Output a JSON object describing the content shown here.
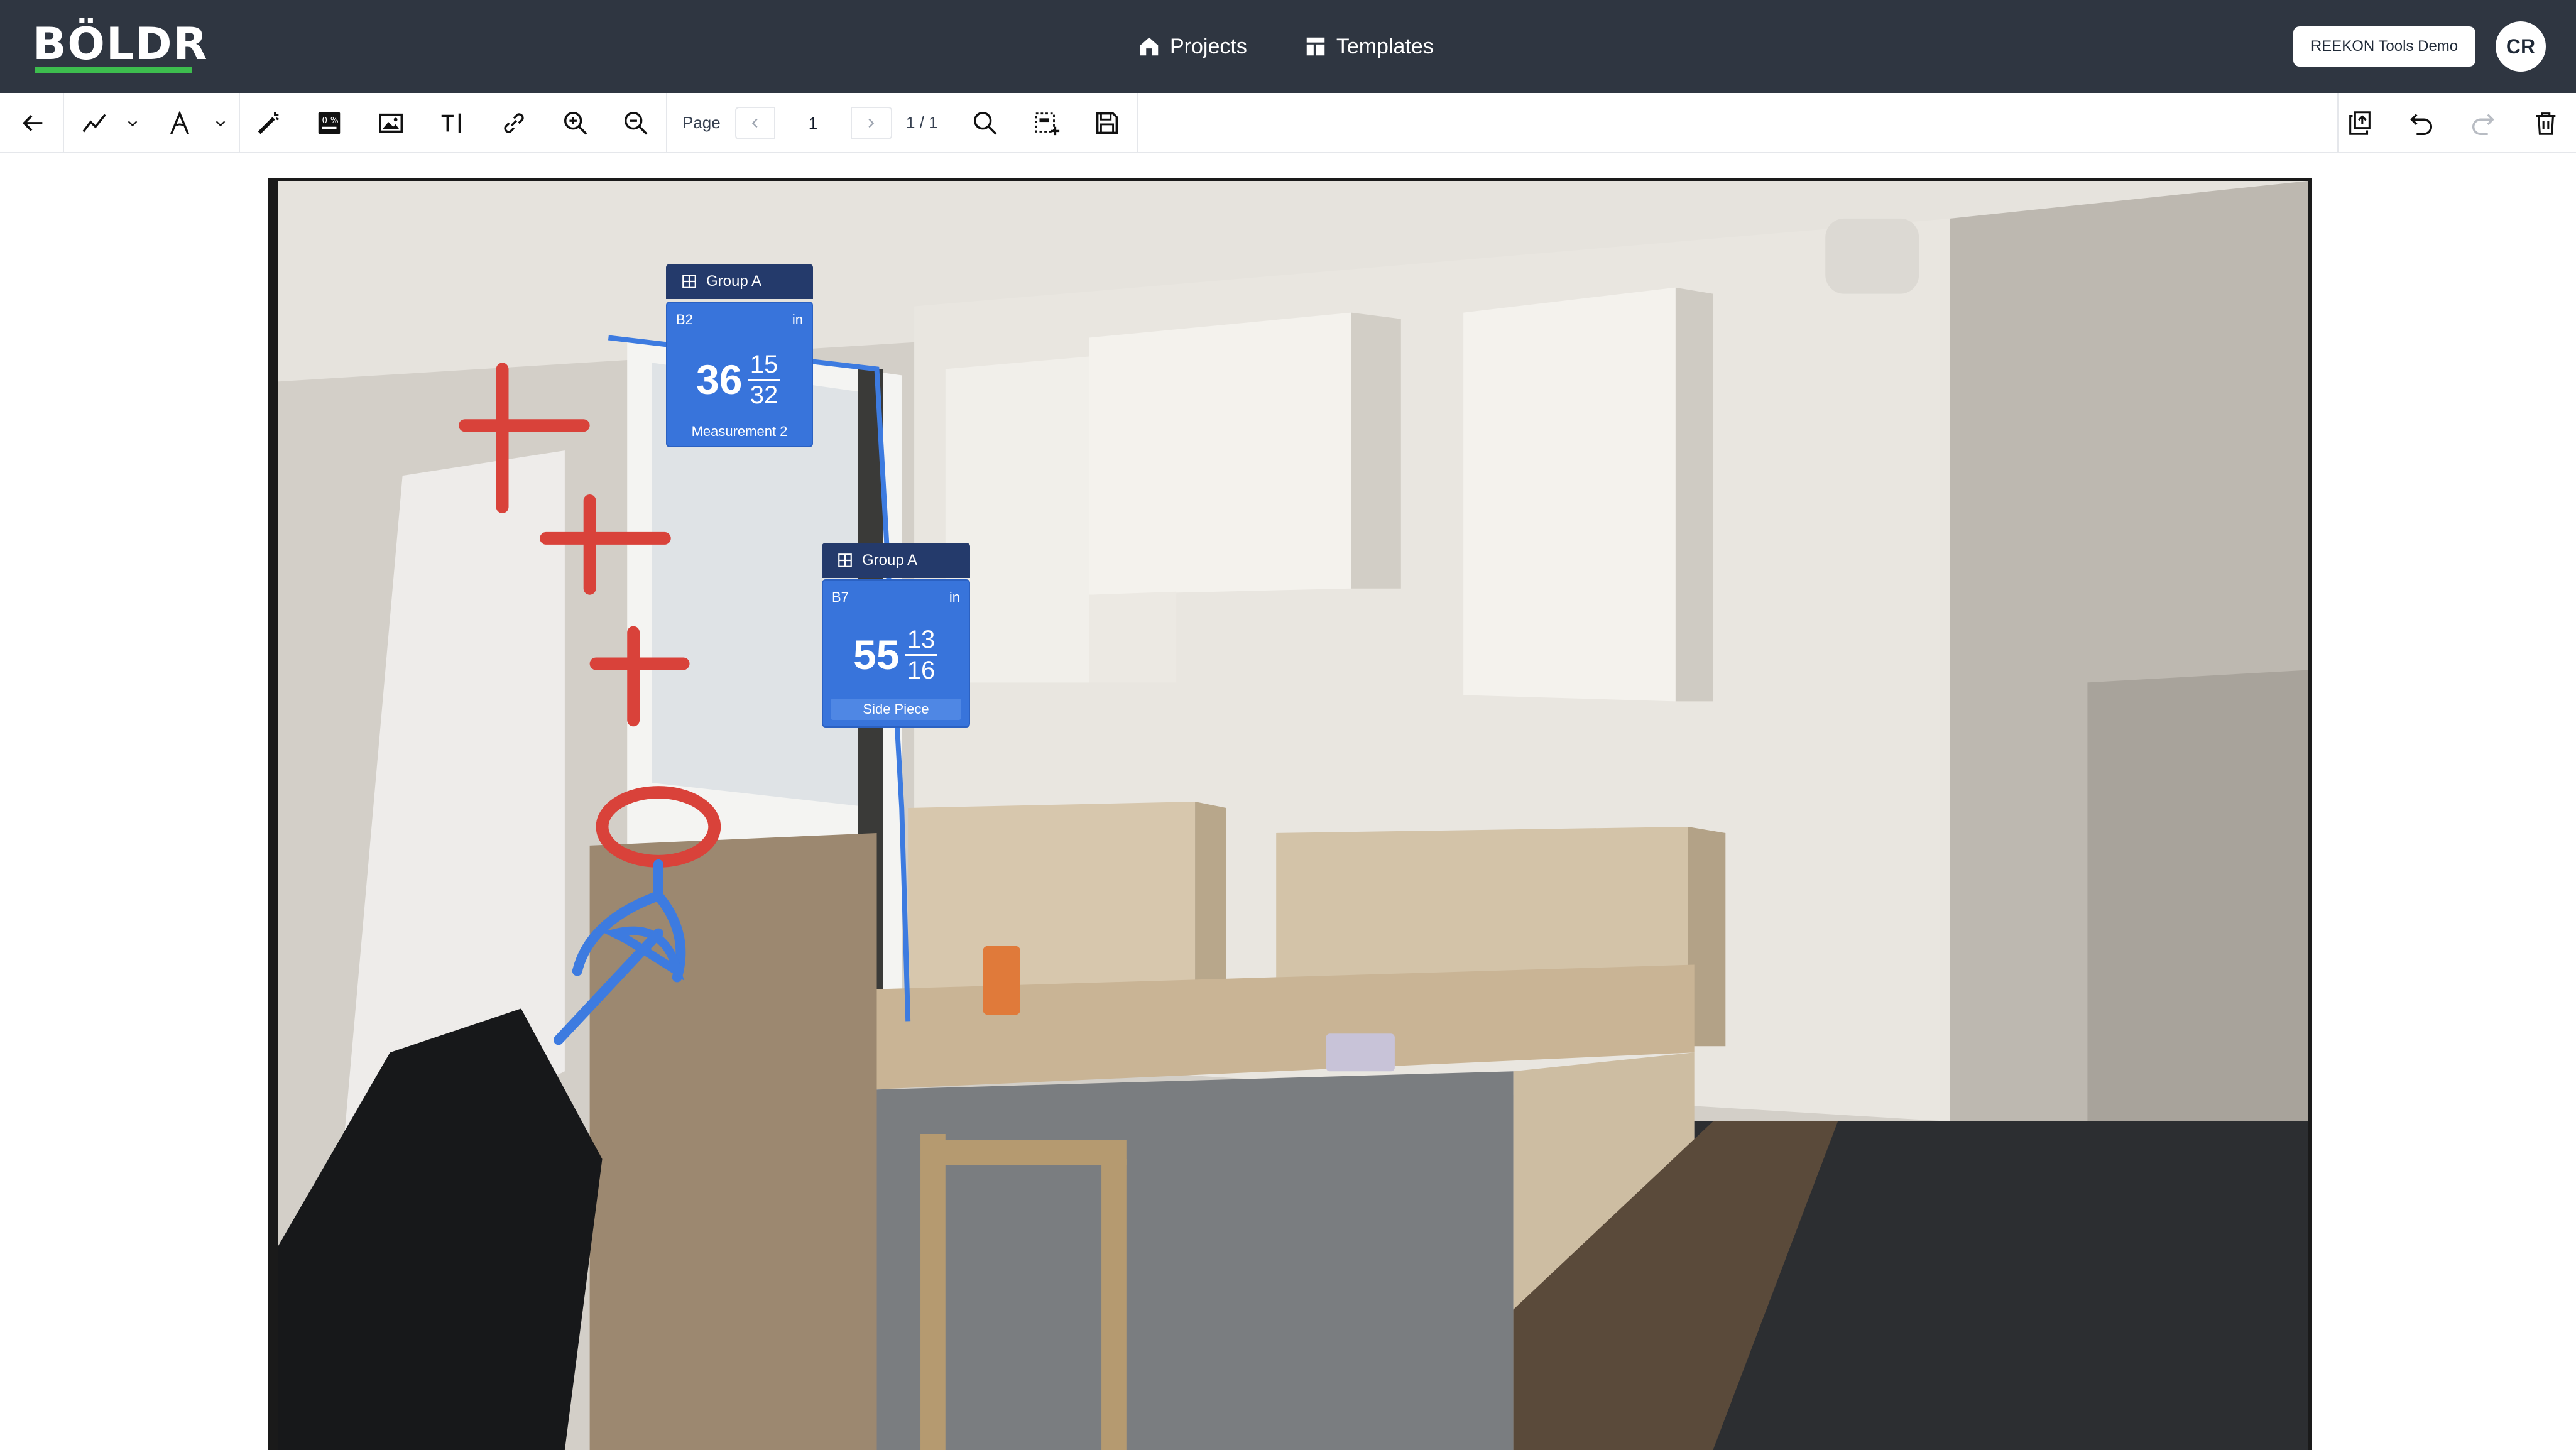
{
  "app": {
    "logo_text": "BÖLDR",
    "brand_color": "#3dbd4e",
    "nav_bg": "#2f3641"
  },
  "nav": {
    "links": [
      {
        "label": "Projects",
        "icon": "home-icon"
      },
      {
        "label": "Templates",
        "icon": "template-icon"
      }
    ],
    "workspace_button": "REEKON Tools Demo",
    "avatar_initials": "CR"
  },
  "toolbar": {
    "left_tools": [
      "back-arrow-icon",
      "polyline-icon",
      "chevron-down-icon",
      "angle-icon",
      "chevron-down-icon",
      "magic-wand-icon",
      "calculator-icon",
      "image-icon",
      "text-icon",
      "link-icon",
      "zoom-in-icon",
      "zoom-out-icon"
    ],
    "page_label": "Page",
    "page_value": "1",
    "page_count": "1 / 1",
    "right_tools": [
      "search-icon",
      "select-area-icon",
      "save-icon",
      "export-icon",
      "undo-icon",
      "redo-icon",
      "trash-icon"
    ]
  },
  "measurements": [
    {
      "group": "Group A",
      "code": "B2",
      "unit": "in",
      "whole": "36",
      "numerator": "15",
      "denominator": "32",
      "caption": "Measurement 2"
    },
    {
      "group": "Group A",
      "code": "B7",
      "unit": "in",
      "whole": "55",
      "numerator": "13",
      "denominator": "16",
      "caption": "Side Piece"
    }
  ],
  "annotation_colors": {
    "red": "#d9423a",
    "blue": "#3d7be0",
    "card": "#3874db",
    "group_tag": "#243a6b"
  }
}
